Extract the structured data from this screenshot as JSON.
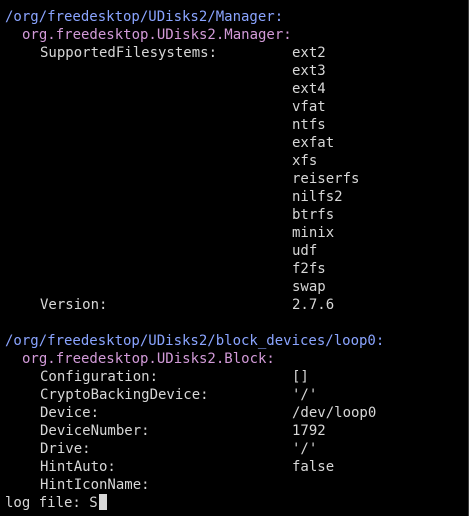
{
  "objects": [
    {
      "path": "/org/freedesktop/UDisks2/Manager:",
      "interface": "org.freedesktop.UDisks2.Manager:",
      "properties": [
        {
          "key": "SupportedFilesystems:",
          "values": [
            "ext2",
            "ext3",
            "ext4",
            "vfat",
            "ntfs",
            "exfat",
            "xfs",
            "reiserfs",
            "nilfs2",
            "btrfs",
            "minix",
            "udf",
            "f2fs",
            "swap"
          ]
        },
        {
          "key": "Version:",
          "values": [
            "2.7.6"
          ]
        }
      ]
    },
    {
      "path": "/org/freedesktop/UDisks2/block_devices/loop0:",
      "interface": "org.freedesktop.UDisks2.Block:",
      "properties": [
        {
          "key": "Configuration:",
          "values": [
            "[]"
          ]
        },
        {
          "key": "CryptoBackingDevice:",
          "values": [
            "'/'"
          ]
        },
        {
          "key": "Device:",
          "values": [
            "/dev/loop0"
          ]
        },
        {
          "key": "DeviceNumber:",
          "values": [
            "1792"
          ]
        },
        {
          "key": "Drive:",
          "values": [
            "'/'"
          ]
        },
        {
          "key": "HintAuto:",
          "values": [
            "false"
          ]
        },
        {
          "key": "HintIconName:",
          "values": [
            ""
          ]
        }
      ]
    }
  ],
  "prompt": {
    "text": "log file: S"
  },
  "colors": {
    "background": "#000000",
    "text": "#d7d7d7",
    "object_path": "#8aa4ff",
    "interface": "#d29ad8"
  }
}
